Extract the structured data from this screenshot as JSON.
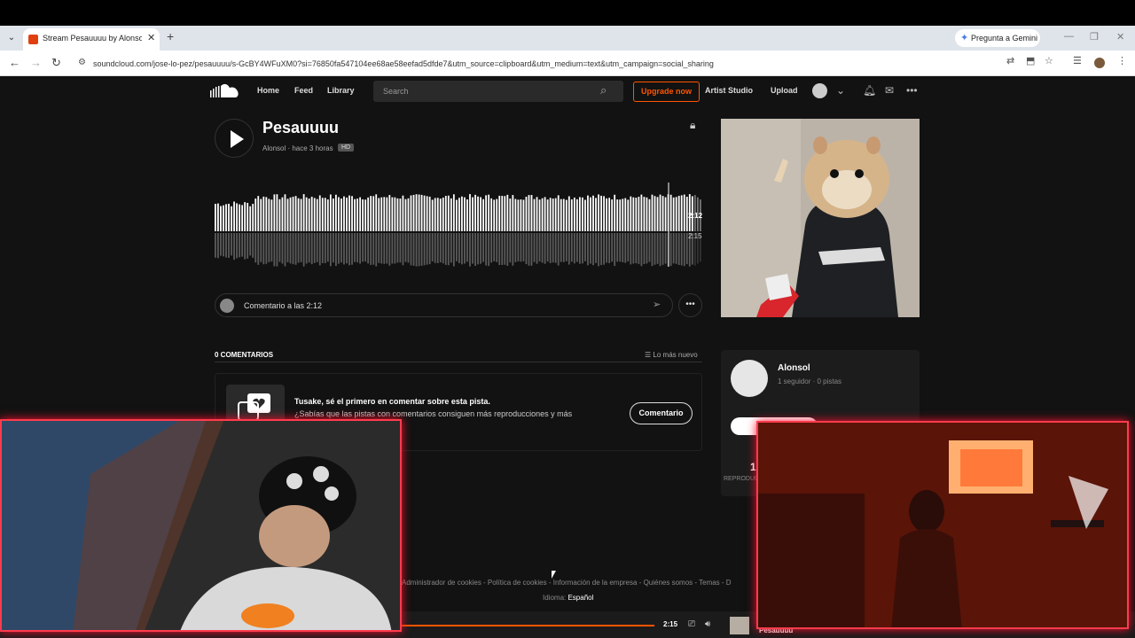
{
  "browser": {
    "tab_title": "Stream Pesauuuu by Alonsol | L",
    "gemini_label": "Pregunta a Gemini",
    "url": "soundcloud.com/jose-lo-pez/pesauuuu/s-GcBY4WFuXM0?si=76850fa547104ee68ae58eefad5dfde7&utm_source=clipboard&utm_medium=text&utm_campaign=social_sharing"
  },
  "header": {
    "nav": [
      "Home",
      "Feed",
      "Library"
    ],
    "search_placeholder": "Search",
    "upgrade_label": "Upgrade now",
    "artist_studio": "Artist Studio",
    "upload": "Upload"
  },
  "track": {
    "title": "Pesauuuu",
    "meta": "Alonsol · hace 3 horas",
    "hd_badge": "HD",
    "current_time": "2:12",
    "duration": "2:15",
    "progress_fraction": 0.98
  },
  "comment": {
    "placeholder": "Comentario a las 2:12",
    "count_label": "0 COMENTARIOS",
    "sort_label": "Lo más nuevo",
    "empty_title": "Tusake, sé el primero en comentar sobre esta pista.",
    "empty_sub": "¿Sabías que las pistas con comentarios consiguen más reproducciones y más",
    "button": "Comentario"
  },
  "artist": {
    "name": "Alonsol",
    "meta": "1 seguidor · 0 pistas",
    "plays": "1",
    "plays_label": "REPRODUC"
  },
  "footer": {
    "links": "Administrador de cookies  -  Política de cookies  -  Información de la empresa  -  Quiénes somos  -  Temas  -  D",
    "lang_label": "Idioma:",
    "lang_value": "Español"
  },
  "player": {
    "time": "2:15",
    "title": "Pesauuuu"
  },
  "colors": {
    "accent": "#ff5500",
    "overlay_border": "#ff3c4d"
  }
}
